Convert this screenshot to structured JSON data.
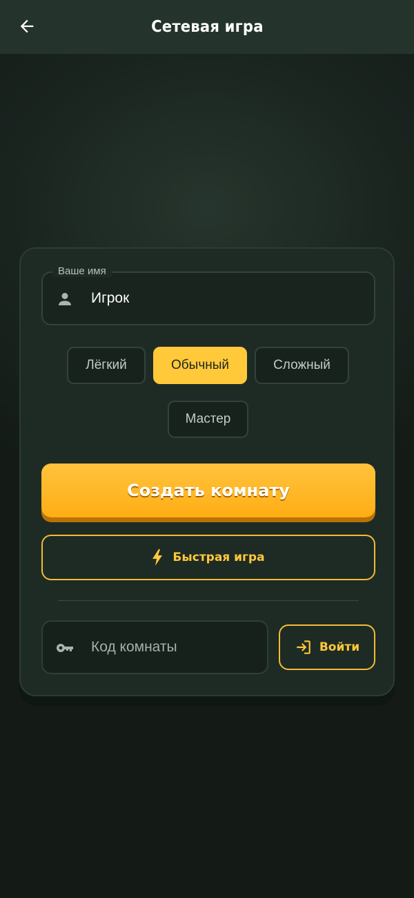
{
  "header": {
    "title": "Сетевая игра",
    "back_icon": "arrow-left-icon"
  },
  "form": {
    "name_field": {
      "label": "Ваше имя",
      "value": "Игрок",
      "icon": "user-icon"
    },
    "difficulty": {
      "options": [
        "Лёгкий",
        "Обычный",
        "Сложный",
        "Мастер"
      ],
      "selected": "Обычный"
    },
    "create_button_label": "Создать комнату",
    "quick_game": {
      "label": "Быстрая игра",
      "icon": "lightning-icon"
    },
    "room_code": {
      "placeholder": "Код комнаты",
      "icon": "key-icon"
    },
    "join": {
      "label": "Войти",
      "icon": "login-icon"
    }
  },
  "colors": {
    "accent": "#ffc93a",
    "background": "#1a241f",
    "card": "#1e2b25",
    "header": "#24332c"
  }
}
